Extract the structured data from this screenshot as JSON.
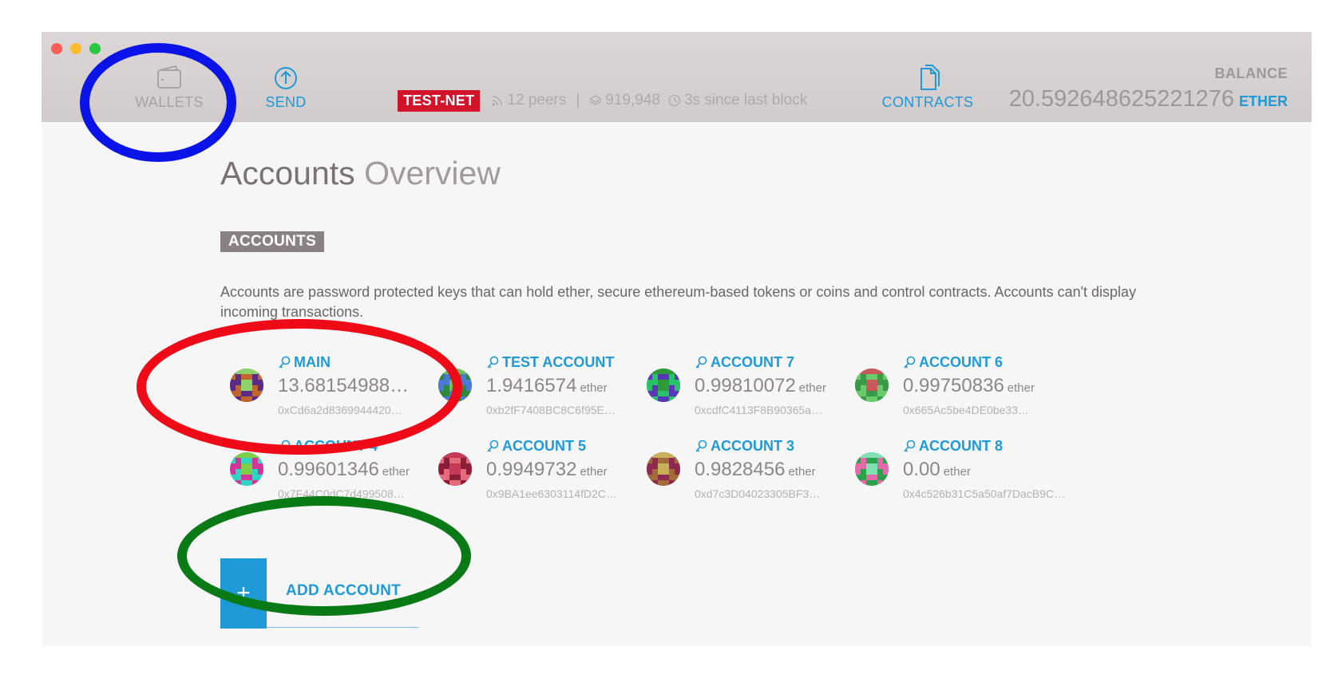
{
  "topbar": {
    "nav": {
      "wallets": "WALLETS",
      "send": "SEND",
      "contracts": "CONTRACTS"
    },
    "network": "TEST-NET",
    "peers": "12 peers",
    "block": "919,948",
    "last_block": "3s since last block",
    "balance_label": "BALANCE",
    "balance_amount": "20.592648625221276",
    "balance_unit": "ETHER"
  },
  "page": {
    "title_main": "Accounts",
    "title_sub": "Overview",
    "section_tag": "ACCOUNTS",
    "description": "Accounts are password protected keys that can hold ether, secure ethereum-based tokens or coins and control contracts. Accounts can't display incoming transactions."
  },
  "accounts": [
    {
      "name": "MAIN",
      "balance": "13.68154988…",
      "unit": "",
      "address": "0xCd6a2d8369944420…",
      "colors": [
        "#5a2c86",
        "#8ed26a",
        "#c0662a"
      ]
    },
    {
      "name": "TEST ACCOUNT",
      "balance": "1.9416574",
      "unit": "ether",
      "address": "0xb2fF7408BC8C6f95E…",
      "colors": [
        "#2a8a3a",
        "#4a7ad6",
        "#6fc05a"
      ]
    },
    {
      "name": "ACCOUNT 7",
      "balance": "0.99810072",
      "unit": "ether",
      "address": "0xcdfC4113F8B90365a…",
      "colors": [
        "#2f9a3a",
        "#5a36b8",
        "#27c26a"
      ]
    },
    {
      "name": "ACCOUNT 6",
      "balance": "0.99750836",
      "unit": "ether",
      "address": "0x665Ac5be4DE0be33…",
      "colors": [
        "#3a9a4a",
        "#c8585a",
        "#6acb6a"
      ]
    },
    {
      "name": "ACCOUNT 4",
      "balance": "0.99601346",
      "unit": "ether",
      "address": "0x7F44C0dC7d499508…",
      "colors": [
        "#2fd4c2",
        "#d2349a",
        "#7ccf46"
      ]
    },
    {
      "name": "ACCOUNT 5",
      "balance": "0.9949732",
      "unit": "ether",
      "address": "0x9BA1ee6303114fD2C…",
      "colors": [
        "#c43a58",
        "#e56a7a",
        "#8a1e38"
      ]
    },
    {
      "name": "ACCOUNT 3",
      "balance": "0.9828456",
      "unit": "ether",
      "address": "0xd7c3D04023305BF3…",
      "colors": [
        "#8e2a52",
        "#c8b05a",
        "#a36a3a"
      ]
    },
    {
      "name": "ACCOUNT 8",
      "balance": "0.00",
      "unit": "ether",
      "address": "0x4c526b31C5a50af7DacB9C…",
      "colors": [
        "#2aa24a",
        "#e26aa8",
        "#7fe0b0"
      ]
    }
  ],
  "add_account": {
    "plus": "+",
    "label": "ADD ACCOUNT"
  },
  "annotation_colors": {
    "blue": "#0a14e8",
    "red": "#ef0a18",
    "green": "#0a7a16"
  },
  "accent_color": "#1f9ad6"
}
